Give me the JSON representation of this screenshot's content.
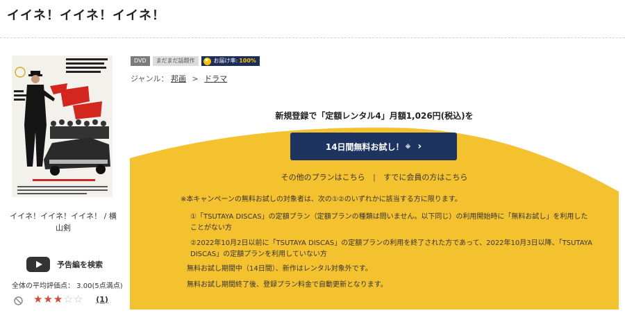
{
  "page": {
    "title": "イイネ！イイネ！イイネ！"
  },
  "poster": {
    "alt": "イイネ！イイネ！イイネ！ poster",
    "caption": "イイネ！イイネ！イイネ！ / 横山剣"
  },
  "trailer": {
    "label": "予告編を検索"
  },
  "rating": {
    "average_text": "全体の平均評価点： 3.00(5点満点)",
    "stars_on": 3,
    "stars_total": 5,
    "stars_display_on": "★★★",
    "stars_display_off": "☆☆",
    "count": "(1)"
  },
  "badges": {
    "format": "DVD",
    "tag": "まだまだ話題作",
    "delivery_label": "お届け率:",
    "delivery_value": "100%"
  },
  "genre": {
    "label": "ジャンル：",
    "level1": "邦画",
    "separator": ">",
    "level2": "ドラマ"
  },
  "campaign": {
    "headline": "新規登録で「定額レンタル4」月額1,026円(税込)を",
    "button_label": "14日間無料お試し！",
    "button_note": "※",
    "button_chevron": "›",
    "other_plans": "その他のプランはこちら",
    "link_separator": "|",
    "members": "すでに会員の方はこちら"
  },
  "notes": {
    "intro": "※本キャンペーンの無料お試しの対象者は、次の①②のいずれかに該当する方に限ります。",
    "cond1": "①「TSUTAYA DISCAS」の定額プラン（定額プランの種類は問いません。以下同じ）の利用開始時に「無料お試し」を利用したことがない方",
    "cond2": "②2022年10月2日以前に「TSUTAYA DISCAS」の定額プランの利用を終了された方であって、2022年10月3日以降、「TSUTAYA DISCAS」の定額プランを利用していない方",
    "trial_period": "無料お試し期間中（14日間）、新作はレンタル対象外です。",
    "after_trial": "無料お試し期間終了後、登録プラン料金で自動更新となります。"
  },
  "colors": {
    "campaign_yellow": "#f5c22f",
    "button_navy": "#1d3360",
    "star_red": "#d8453b"
  }
}
